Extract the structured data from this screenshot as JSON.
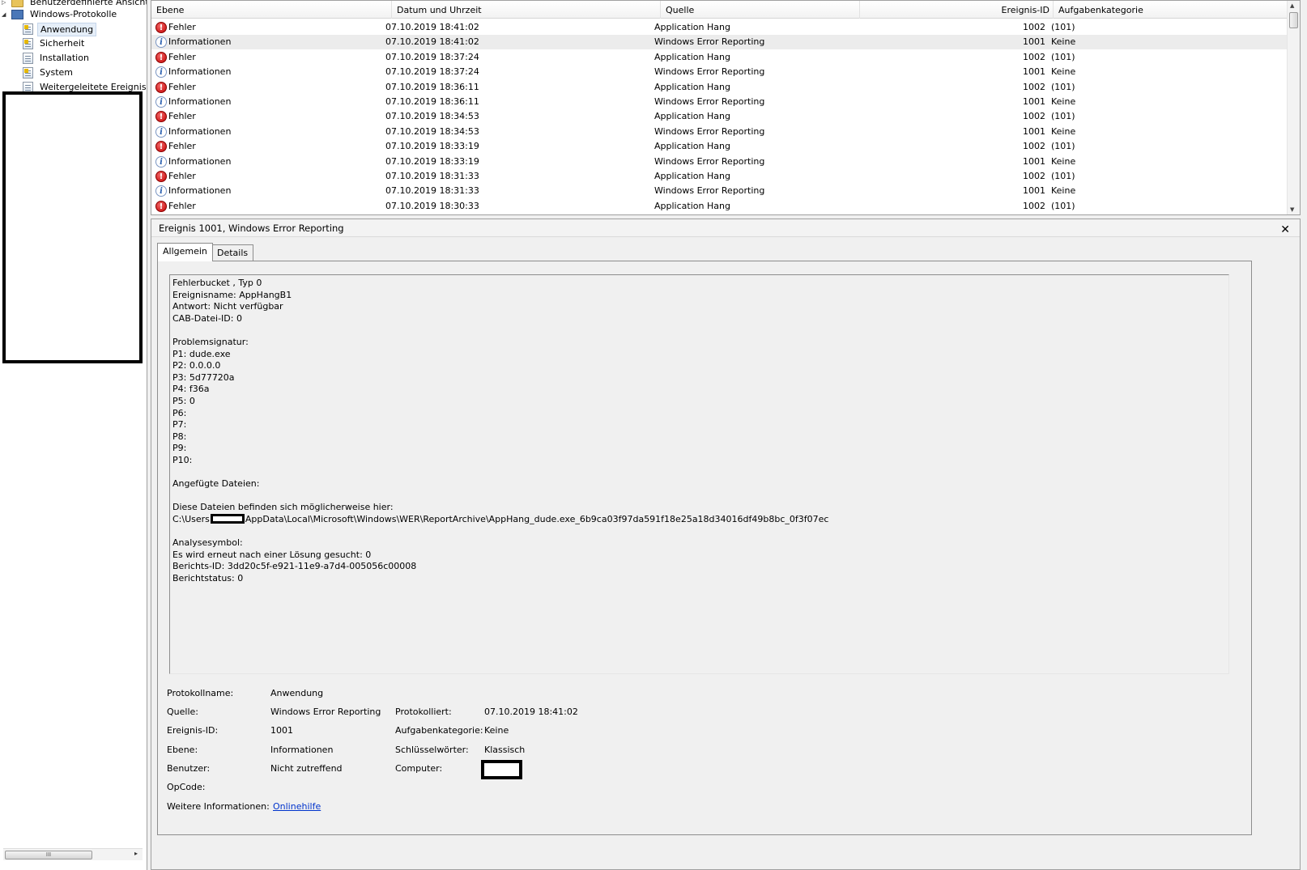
{
  "tree": {
    "items": [
      {
        "label": "Benutzerdefinierte Ansichten",
        "icon": "folder-icon",
        "expander": "▷"
      },
      {
        "label": "Windows-Protokolle",
        "icon": "monitor-icon",
        "expander": "◢"
      },
      {
        "label": "Anwendung",
        "icon": "log-warning-icon"
      },
      {
        "label": "Sicherheit",
        "icon": "log-warning-icon"
      },
      {
        "label": "Installation",
        "icon": "log-icon"
      },
      {
        "label": "System",
        "icon": "log-warning-icon"
      },
      {
        "label": "Weitergeleitete Ereignisse",
        "icon": "log-icon"
      }
    ],
    "scroll_grip": "III",
    "scroll_arrow": "▸"
  },
  "events": {
    "columns": {
      "level": "Ebene",
      "date": "Datum und Uhrzeit",
      "source": "Quelle",
      "id": "Ereignis-ID",
      "category": "Aufgabenkategorie"
    },
    "rows": [
      {
        "level": "Fehler",
        "type": "error",
        "date": "07.10.2019 18:41:02",
        "source": "Application Hang",
        "id": "1002",
        "category": "(101)"
      },
      {
        "level": "Informationen",
        "type": "info",
        "date": "07.10.2019 18:41:02",
        "source": "Windows Error Reporting",
        "id": "1001",
        "category": "Keine",
        "selected": true
      },
      {
        "level": "Fehler",
        "type": "error",
        "date": "07.10.2019 18:37:24",
        "source": "Application Hang",
        "id": "1002",
        "category": "(101)"
      },
      {
        "level": "Informationen",
        "type": "info",
        "date": "07.10.2019 18:37:24",
        "source": "Windows Error Reporting",
        "id": "1001",
        "category": "Keine"
      },
      {
        "level": "Fehler",
        "type": "error",
        "date": "07.10.2019 18:36:11",
        "source": "Application Hang",
        "id": "1002",
        "category": "(101)"
      },
      {
        "level": "Informationen",
        "type": "info",
        "date": "07.10.2019 18:36:11",
        "source": "Windows Error Reporting",
        "id": "1001",
        "category": "Keine"
      },
      {
        "level": "Fehler",
        "type": "error",
        "date": "07.10.2019 18:34:53",
        "source": "Application Hang",
        "id": "1002",
        "category": "(101)"
      },
      {
        "level": "Informationen",
        "type": "info",
        "date": "07.10.2019 18:34:53",
        "source": "Windows Error Reporting",
        "id": "1001",
        "category": "Keine"
      },
      {
        "level": "Fehler",
        "type": "error",
        "date": "07.10.2019 18:33:19",
        "source": "Application Hang",
        "id": "1002",
        "category": "(101)"
      },
      {
        "level": "Informationen",
        "type": "info",
        "date": "07.10.2019 18:33:19",
        "source": "Windows Error Reporting",
        "id": "1001",
        "category": "Keine"
      },
      {
        "level": "Fehler",
        "type": "error",
        "date": "07.10.2019 18:31:33",
        "source": "Application Hang",
        "id": "1002",
        "category": "(101)"
      },
      {
        "level": "Informationen",
        "type": "info",
        "date": "07.10.2019 18:31:33",
        "source": "Windows Error Reporting",
        "id": "1001",
        "category": "Keine"
      },
      {
        "level": "Fehler",
        "type": "error",
        "date": "07.10.2019 18:30:33",
        "source": "Application Hang",
        "id": "1002",
        "category": "(101)"
      }
    ]
  },
  "detail": {
    "title": "Ereignis 1001, Windows Error Reporting",
    "close": "✕",
    "tabs": {
      "general": "Allgemein",
      "details": "Details"
    },
    "text_lines": [
      "Fehlerbucket , Typ 0",
      "Ereignisname: AppHangB1",
      "Antwort: Nicht verfügbar",
      "CAB-Datei-ID: 0",
      "",
      "Problemsignatur:",
      "P1: dude.exe",
      "P2: 0.0.0.0",
      "P3: 5d77720a",
      "P4: f36a",
      "P5: 0",
      "P6:",
      "P7:",
      "P8:",
      "P9:",
      "P10:",
      "",
      "Angefügte Dateien:",
      "",
      "Diese Dateien befinden sich möglicherweise hier:"
    ],
    "path_prefix": "C:\\Users",
    "path_suffix": "AppData\\Local\\Microsoft\\Windows\\WER\\ReportArchive\\AppHang_dude.exe_6b9ca03f97da591f18e25a18d34016df49b8bc_0f3f07ec",
    "text_lines_after": [
      "",
      "Analysesymbol:",
      "Es wird erneut nach einer Lösung gesucht: 0",
      "Berichts-ID: 3dd20c5f-e921-11e9-a7d4-005056c00008",
      "Berichtstatus: 0"
    ],
    "props": {
      "logname_label": "Protokollname:",
      "logname": "Anwendung",
      "source_label": "Quelle:",
      "source": "Windows Error Reporting",
      "logged_label": "Protokolliert:",
      "logged": "07.10.2019 18:41:02",
      "eventid_label": "Ereignis-ID:",
      "eventid": "1001",
      "category_label": "Aufgabenkategorie:",
      "category": "Keine",
      "level_label": "Ebene:",
      "level": "Informationen",
      "keywords_label": "Schlüsselwörter:",
      "keywords": "Klassisch",
      "user_label": "Benutzer:",
      "user": "Nicht zutreffend",
      "computer_label": "Computer:",
      "opcode_label": "OpCode:",
      "moreinfo_label": "Weitere Informationen:",
      "moreinfo_link": "Onlinehilfe"
    }
  },
  "colors": {
    "error": "#c40000",
    "info": "#2a5fb0",
    "link": "#0033cc",
    "selection": "#e5eef8"
  }
}
